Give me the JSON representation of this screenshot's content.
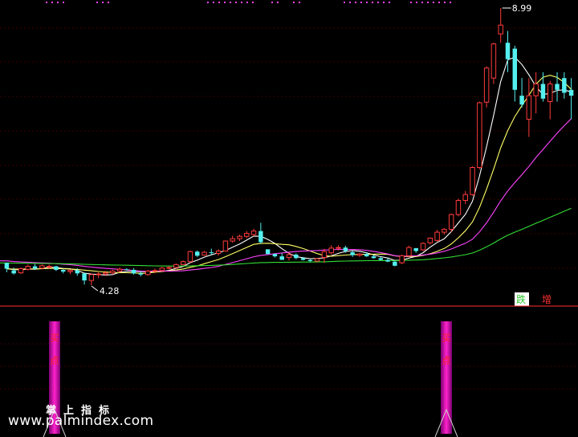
{
  "chart_data": {
    "type": "candlestick",
    "price_panel": {
      "high_label": "8.99",
      "low_label": "4.28",
      "legend": [
        {
          "label": "跌",
          "color": "#2ec82e"
        },
        {
          "label": "增",
          "color": "#ff3030"
        }
      ],
      "up_color": "#ff3b3b",
      "down_color": "#54f0f0",
      "ma_colors": [
        "#ffffff",
        "#ffff66",
        "#ff44ff",
        "#33dd33"
      ],
      "candles": [
        [
          4.66,
          4.66,
          4.5,
          4.56
        ],
        [
          4.53,
          4.58,
          4.46,
          4.48
        ],
        [
          4.49,
          4.58,
          4.47,
          4.56
        ],
        [
          4.55,
          4.63,
          4.53,
          4.6
        ],
        [
          4.6,
          4.64,
          4.54,
          4.56
        ],
        [
          4.57,
          4.63,
          4.55,
          4.61
        ],
        [
          4.6,
          4.63,
          4.56,
          4.6
        ],
        [
          4.6,
          4.61,
          4.52,
          4.54
        ],
        [
          4.54,
          4.55,
          4.48,
          4.51
        ],
        [
          4.51,
          4.55,
          4.47,
          4.53
        ],
        [
          4.53,
          4.57,
          4.44,
          4.48
        ],
        [
          4.48,
          4.49,
          4.29,
          4.36
        ],
        [
          4.36,
          4.48,
          4.28,
          4.46
        ],
        [
          4.46,
          4.5,
          4.4,
          4.47
        ],
        [
          4.47,
          4.52,
          4.44,
          4.49
        ],
        [
          4.49,
          4.54,
          4.46,
          4.52
        ],
        [
          4.52,
          4.58,
          4.5,
          4.55
        ],
        [
          4.55,
          4.57,
          4.53,
          4.54
        ],
        [
          4.54,
          4.57,
          4.46,
          4.48
        ],
        [
          4.48,
          4.52,
          4.43,
          4.46
        ],
        [
          4.46,
          4.54,
          4.44,
          4.52
        ],
        [
          4.52,
          4.56,
          4.48,
          4.53
        ],
        [
          4.53,
          4.59,
          4.51,
          4.57
        ],
        [
          4.57,
          4.6,
          4.55,
          4.58
        ],
        [
          4.58,
          4.65,
          4.56,
          4.63
        ],
        [
          4.63,
          4.7,
          4.62,
          4.68
        ],
        [
          4.68,
          4.87,
          4.66,
          4.85
        ],
        [
          4.85,
          4.87,
          4.76,
          4.78
        ],
        [
          4.79,
          4.86,
          4.78,
          4.84
        ],
        [
          4.84,
          4.9,
          4.79,
          4.83
        ],
        [
          4.82,
          4.89,
          4.78,
          4.86
        ],
        [
          4.86,
          5.04,
          4.85,
          5.03
        ],
        [
          5.03,
          5.12,
          5.0,
          5.07
        ],
        [
          5.07,
          5.14,
          5.03,
          5.11
        ],
        [
          5.11,
          5.2,
          5.08,
          5.16
        ],
        [
          5.14,
          5.24,
          5.11,
          5.2
        ],
        [
          5.2,
          5.34,
          4.98,
          5.01
        ],
        [
          4.89,
          4.89,
          4.8,
          4.81
        ],
        [
          4.81,
          4.82,
          4.75,
          4.77
        ],
        [
          4.77,
          4.82,
          4.71,
          4.71
        ],
        [
          4.75,
          4.84,
          4.7,
          4.8
        ],
        [
          4.8,
          4.82,
          4.72,
          4.74
        ],
        [
          4.74,
          4.76,
          4.7,
          4.71
        ],
        [
          4.71,
          4.72,
          4.67,
          4.69
        ],
        [
          4.69,
          4.74,
          4.67,
          4.73
        ],
        [
          4.75,
          4.9,
          4.66,
          4.85
        ],
        [
          4.83,
          4.96,
          4.8,
          4.91
        ],
        [
          4.91,
          4.96,
          4.87,
          4.92
        ],
        [
          4.92,
          4.95,
          4.83,
          4.86
        ],
        [
          4.84,
          4.86,
          4.76,
          4.79
        ],
        [
          4.79,
          4.83,
          4.76,
          4.81
        ],
        [
          4.81,
          4.84,
          4.76,
          4.77
        ],
        [
          4.77,
          4.79,
          4.73,
          4.74
        ],
        [
          4.74,
          4.76,
          4.7,
          4.71
        ],
        [
          4.71,
          4.74,
          4.67,
          4.68
        ],
        [
          4.68,
          4.7,
          4.6,
          4.61
        ],
        [
          4.66,
          4.8,
          4.64,
          4.78
        ],
        [
          4.78,
          4.95,
          4.76,
          4.92
        ],
        [
          4.91,
          4.91,
          4.83,
          4.86
        ],
        [
          4.88,
          5.01,
          4.86,
          4.99
        ],
        [
          5.0,
          5.09,
          4.97,
          5.08
        ],
        [
          5.04,
          5.22,
          5.02,
          5.18
        ],
        [
          5.18,
          5.25,
          5.14,
          5.23
        ],
        [
          5.23,
          5.5,
          5.18,
          5.48
        ],
        [
          5.48,
          5.75,
          5.45,
          5.72
        ],
        [
          5.72,
          5.88,
          5.66,
          5.82
        ],
        [
          5.82,
          6.3,
          5.8,
          6.28
        ],
        [
          6.28,
          7.4,
          6.25,
          7.38
        ],
        [
          7.39,
          8.0,
          7.3,
          7.97
        ],
        [
          7.8,
          8.4,
          7.7,
          8.38
        ],
        [
          8.55,
          8.99,
          8.4,
          8.7
        ],
        [
          8.4,
          8.6,
          7.9,
          8.12
        ],
        [
          8.3,
          8.35,
          7.4,
          7.6
        ],
        [
          7.5,
          7.8,
          7.3,
          7.35
        ],
        [
          7.1,
          7.8,
          6.8,
          7.5
        ],
        [
          7.5,
          7.9,
          7.2,
          7.7
        ],
        [
          7.7,
          7.9,
          7.4,
          7.45
        ],
        [
          7.4,
          7.75,
          7.1,
          7.7
        ],
        [
          7.7,
          7.9,
          7.4,
          7.6
        ],
        [
          7.8,
          7.9,
          7.45,
          7.55
        ],
        [
          7.6,
          7.8,
          7.1,
          7.5
        ]
      ]
    },
    "indicator_panel": {
      "signals": [
        {
          "label": "买点",
          "color": "#ff22cc",
          "text_color": "#ff2222",
          "height": 100
        },
        {
          "label": "买点",
          "color": "#ff22cc",
          "text_color": "#ff2222",
          "height": 100
        }
      ]
    }
  },
  "watermark": {
    "brand": "掌上指标",
    "site": "www.palmindex.com"
  }
}
